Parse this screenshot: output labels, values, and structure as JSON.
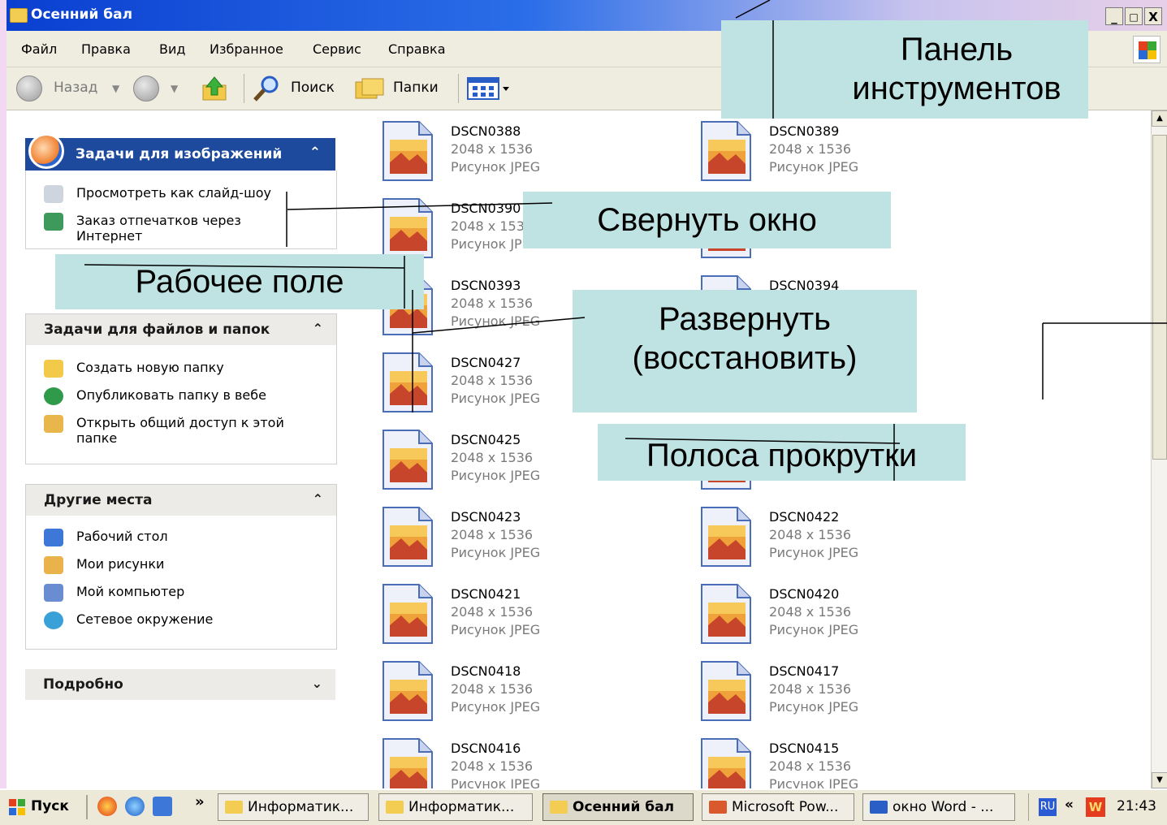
{
  "window": {
    "title": "Осенний бал",
    "buttons": [
      "_",
      "□",
      "X"
    ]
  },
  "menu": [
    "Файл",
    "Правка",
    "Вид",
    "Избранное",
    "Сервис",
    "Справка"
  ],
  "toolbar": {
    "back": "Назад",
    "search": "Поиск",
    "folders": "Папки"
  },
  "left_pane": {
    "image_tasks": {
      "title": "Задачи для изображений",
      "items": [
        "Просмотреть как слайд-шоу",
        "Заказ отпечатков через Интернет"
      ]
    },
    "file_tasks": {
      "title": "Задачи для файлов и папок",
      "items": [
        "Создать новую папку",
        "Опубликовать папку в вебе",
        "Открыть общий доступ к этой папке"
      ]
    },
    "other_places": {
      "title": "Другие места",
      "items": [
        "Рабочий стол",
        "Мои рисунки",
        "Мой компьютер",
        "Сетевое окружение"
      ]
    },
    "details": {
      "title": "Подробно"
    }
  },
  "files": [
    {
      "name": "DSCN0388",
      "size": "2048 x 1536",
      "type": "Рисунок JPEG"
    },
    {
      "name": "DSCN0389",
      "size": "2048 x 1536",
      "type": "Рисунок JPEG"
    },
    {
      "name": "DSCN0390",
      "size": "2048 x 153",
      "type": "Рисунок JP"
    },
    {
      "name": "",
      "size": "",
      "type": ""
    },
    {
      "name": "DSCN0393",
      "size": "2048 x 1536",
      "type": "Рисунок JPEG"
    },
    {
      "name": "DSCN0394",
      "size": "",
      "type": ""
    },
    {
      "name": "DSCN0427",
      "size": "2048 x 1536",
      "type": "Рисунок JPEG"
    },
    {
      "name": "",
      "size": "",
      "type": ""
    },
    {
      "name": "DSCN0425",
      "size": "2048 x 1536",
      "type": "Рисунок JPEG"
    },
    {
      "name": "",
      "size": "",
      "type": ""
    },
    {
      "name": "DSCN0423",
      "size": "2048 x 1536",
      "type": "Рисунок JPEG"
    },
    {
      "name": "DSCN0422",
      "size": "2048 x 1536",
      "type": "Рисунок JPEG"
    },
    {
      "name": "DSCN0421",
      "size": "2048 x 1536",
      "type": "Рисунок JPEG"
    },
    {
      "name": "DSCN0420",
      "size": "2048 x 1536",
      "type": "Рисунок JPEG"
    },
    {
      "name": "DSCN0418",
      "size": "2048 x 1536",
      "type": "Рисунок JPEG"
    },
    {
      "name": "DSCN0417",
      "size": "2048 x 1536",
      "type": "Рисунок JPEG"
    },
    {
      "name": "DSCN0416",
      "size": "2048 x 1536",
      "type": "Рисунок JPEG"
    },
    {
      "name": "DSCN0415",
      "size": "2048 x 1536",
      "type": "Рисунок JPEG"
    }
  ],
  "annotations": {
    "toolbar": "Панель инструментов",
    "minimize": "Свернуть окно",
    "workspace": "Рабочее поле",
    "maximize_line1": "Развернуть",
    "maximize_line2": "(восстановить)",
    "scrollbar": "Полоса прокрутки"
  },
  "taskbar": {
    "start": "Пуск",
    "more": "»",
    "tasks": [
      "Информатик...",
      "Информатик...",
      "Осенний бал",
      "Microsoft Pow...",
      "окно Word - ..."
    ],
    "lang": "RU",
    "tray_chevrons": "«",
    "tray_app": "W",
    "time": "21:43"
  },
  "colors": {
    "title_bar": "#0a3fd0",
    "callout_bg": "#bfe3e3",
    "task_head": "#1d4a9d",
    "page_bg": "#f2d8f2"
  }
}
